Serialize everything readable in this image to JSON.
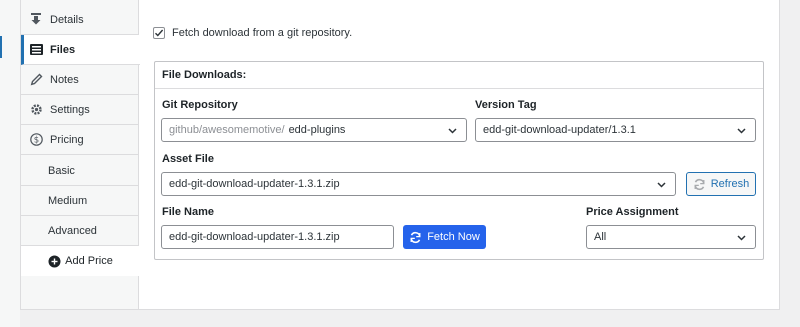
{
  "tabs": {
    "details": "Details",
    "files": "Files",
    "notes": "Notes",
    "settings": "Settings",
    "pricing": "Pricing",
    "basic": "Basic",
    "medium": "Medium",
    "advanced": "Advanced",
    "add_price": "Add Price"
  },
  "fetch_option": {
    "label": "Fetch download from a git repository.",
    "checked": true
  },
  "file_downloads": {
    "title": "File Downloads:",
    "git_repository": {
      "label": "Git Repository",
      "owner": "github/awesomemotive/",
      "repo": "edd-plugins"
    },
    "version_tag": {
      "label": "Version Tag",
      "value": "edd-git-download-updater/1.3.1"
    },
    "asset_file": {
      "label": "Asset File",
      "value": "edd-git-download-updater-1.3.1.zip",
      "refresh_label": "Refresh"
    },
    "file_name": {
      "label": "File Name",
      "value": "edd-git-download-updater-1.3.1.zip",
      "fetch_label": "Fetch Now"
    },
    "price_assignment": {
      "label": "Price Assignment",
      "value": "All"
    }
  },
  "colors": {
    "accent": "#2271b1",
    "fetch_button": "#2563eb",
    "border": "#c3c4c7"
  }
}
